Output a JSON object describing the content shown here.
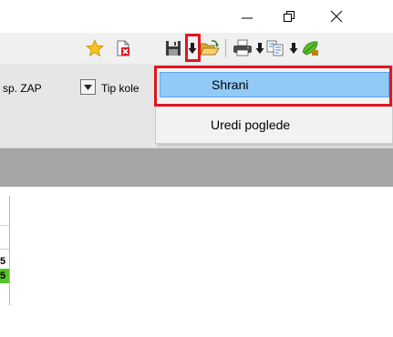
{
  "window": {
    "minimize_glyph": "—",
    "restore_glyph": "🗗",
    "close_glyph": "✕"
  },
  "toolbar": {
    "icons": [
      "star-icon",
      "delete-document-icon",
      "save-icon",
      "save-dropdown-arrow",
      "open-folder-icon",
      "print-icon",
      "print-dropdown-arrow",
      "export-icon",
      "export-dropdown-arrow",
      "tools-icon"
    ]
  },
  "filters": {
    "field1_label": "sp. ZAP",
    "field2_label": "Tip kole"
  },
  "grid": {
    "cell1": "5",
    "cell2": "5"
  },
  "save_menu": {
    "items": [
      {
        "label": "Shrani"
      },
      {
        "label": "Uredi poglede"
      }
    ]
  },
  "colors": {
    "highlight": "#91c9f7",
    "annotation_red": "#e0161f",
    "status_green": "#57c22b",
    "toolbar_bg": "#f0f0f0",
    "header_gray": "#a5a5a5"
  }
}
